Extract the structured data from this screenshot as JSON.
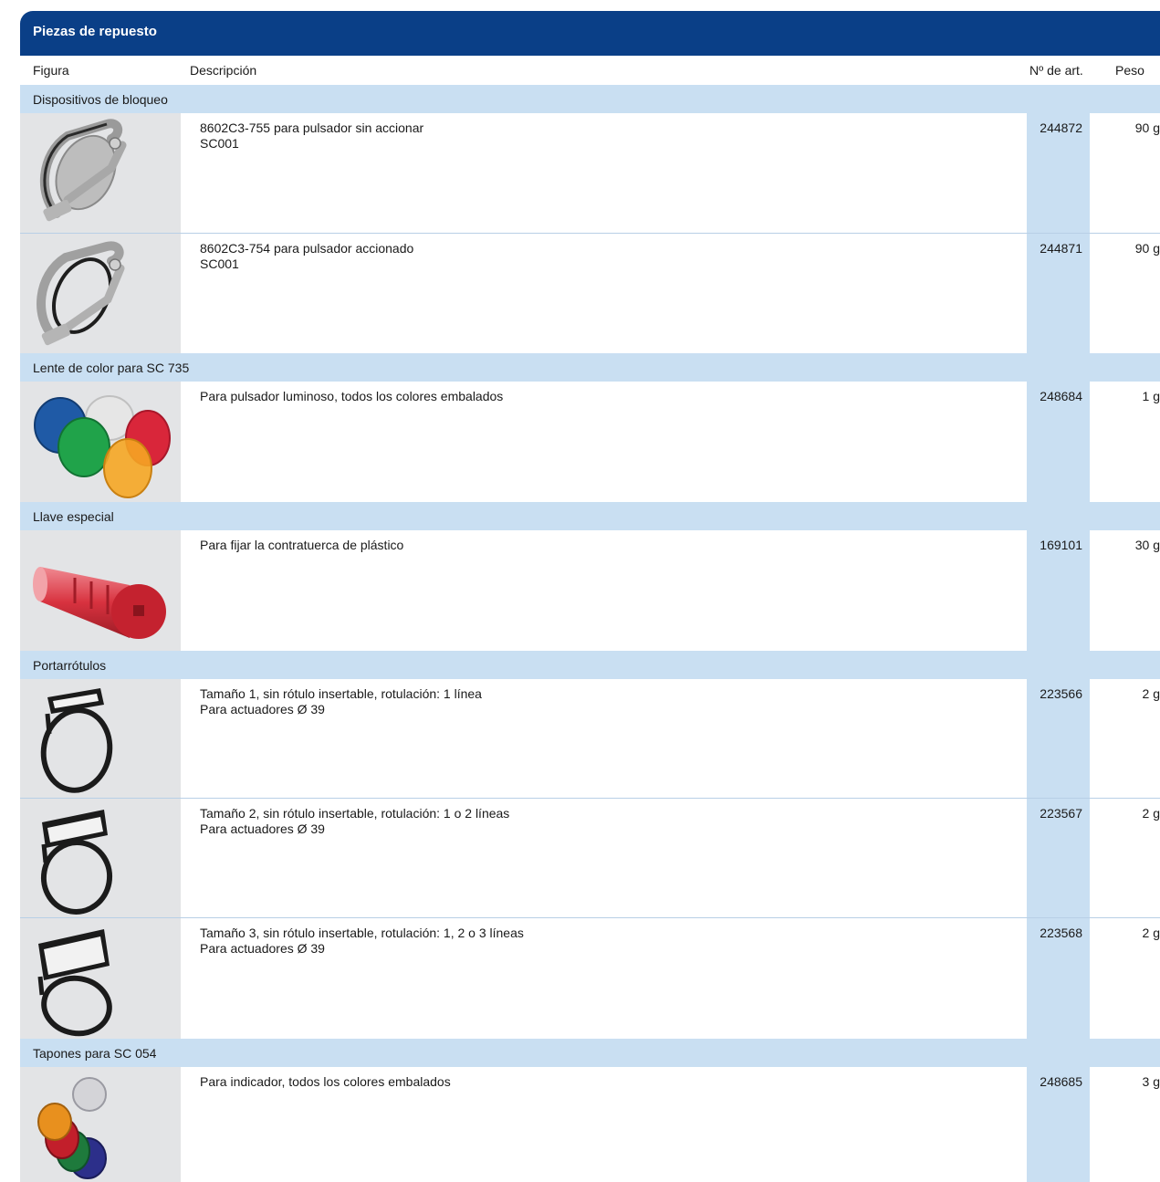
{
  "header": {
    "title": "Piezas de repuesto"
  },
  "columns": {
    "figure": "Figura",
    "description": "Descripción",
    "article": "Nº de art.",
    "weight": "Peso"
  },
  "categories": [
    {
      "name": "Dispositivos de bloqueo",
      "items": [
        {
          "icon": "locking-clamp-icon",
          "line1": "8602C3-755 para pulsador sin accionar",
          "line2": "SC001",
          "article": "244872",
          "weight": "90 g"
        },
        {
          "icon": "locking-clamp-icon",
          "line1": "8602C3-754 para pulsador accionado",
          "line2": "SC001",
          "article": "244871",
          "weight": "90 g"
        }
      ]
    },
    {
      "name": "Lente de color para SC 735",
      "items": [
        {
          "icon": "color-lenses-icon",
          "line1": "Para pulsador luminoso, todos los colores embalados",
          "line2": "",
          "article": "248684",
          "weight": "1 g"
        }
      ]
    },
    {
      "name": "Llave especial",
      "items": [
        {
          "icon": "special-key-icon",
          "line1": "Para fijar la contratuerca de plástico",
          "line2": "",
          "article": "169101",
          "weight": "30 g"
        }
      ]
    },
    {
      "name": "Portarrótulos",
      "items": [
        {
          "icon": "label-holder-icon",
          "line1": "Tamaño 1, sin rótulo insertable, rotulación: 1 línea",
          "line2": "Para actuadores Ø 39",
          "article": "223566",
          "weight": "2 g"
        },
        {
          "icon": "label-holder-icon",
          "line1": "Tamaño 2, sin rótulo insertable, rotulación: 1 o 2 líneas",
          "line2": "Para actuadores Ø 39",
          "article": "223567",
          "weight": "2 g"
        },
        {
          "icon": "label-holder-icon",
          "line1": "Tamaño 3, sin rótulo insertable, rotulación: 1, 2 o 3 líneas",
          "line2": "Para actuadores Ø 39",
          "article": "223568",
          "weight": "2 g"
        }
      ]
    },
    {
      "name": "Tapones para SC 054",
      "items": [
        {
          "icon": "indicator-caps-icon",
          "line1": "Para indicador, todos los colores embalados",
          "line2": "",
          "article": "248685",
          "weight": "3 g"
        }
      ]
    }
  ],
  "colors": {
    "header_blue": "#0a3f87",
    "category_band": "#c9dff2",
    "figure_bg": "#e3e4e6"
  }
}
